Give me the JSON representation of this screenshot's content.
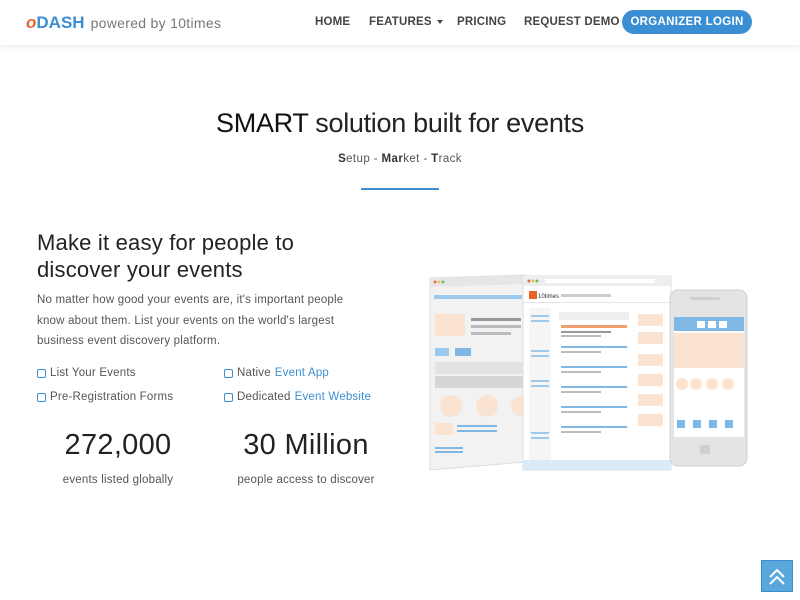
{
  "nav": {
    "brand_o": "o",
    "brand_dash": "DASH",
    "brand_powered": "powered by 10times",
    "home": "HOME",
    "features": "FEATURES",
    "pricing": "PRICING",
    "request_demo": "REQUEST DEMO",
    "organizer_login": "ORGANIZER LOGIN"
  },
  "hero": {
    "title_smart": "SMART",
    "title_rest": " solution built for events",
    "sub_s": "S",
    "sub_etup": "etup - ",
    "sub_mar": "Mar",
    "sub_ket": "ket - ",
    "sub_t": "T",
    "sub_rack": "rack"
  },
  "content": {
    "heading": "Make it easy for people to discover your events",
    "description": "No matter how good your events are, it's important people know about them. List your events on the world's largest business event discovery platform.",
    "features": [
      {
        "text": "List Your Events",
        "link": ""
      },
      {
        "text": "Native",
        "link": "Event App"
      },
      {
        "text": "Pre-Registration Forms",
        "link": ""
      },
      {
        "text": "Dedicated",
        "link": "Event Website"
      }
    ],
    "stats": [
      {
        "value": "272,000",
        "label": "events listed globally"
      },
      {
        "value": "30 Million",
        "label": "people access to discover"
      }
    ]
  },
  "illustration": {
    "logo_text": "10times"
  },
  "colors": {
    "accent": "#3a8fd4",
    "brand_orange": "#e8622a",
    "placeholder_peach": "#fbe3d2"
  },
  "icons": {
    "scroll_top": "double-chevron-up-icon",
    "feature_checkbox": "checkbox-icon"
  }
}
